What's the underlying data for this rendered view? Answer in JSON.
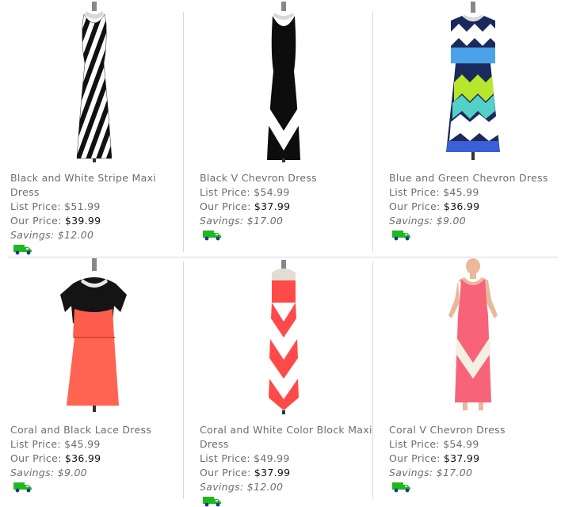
{
  "labels": {
    "list_price": "List Price:",
    "our_price": "Our Price:",
    "savings": "Savings:"
  },
  "products": [
    {
      "title": "Black and White Stripe Maxi Dress",
      "list_price": "$51.99",
      "our_price": "$39.99",
      "savings": "$12.00",
      "icon": "shipping-truck-icon"
    },
    {
      "title": "Black V Chevron Dress",
      "list_price": "$54.99",
      "our_price": "$37.99",
      "savings": "$17.00",
      "icon": "shipping-truck-icon"
    },
    {
      "title": "Blue and Green Chevron Dress",
      "list_price": "$45.99",
      "our_price": "$36.99",
      "savings": "$9.00",
      "icon": "shipping-truck-icon"
    },
    {
      "title": "Coral and Black Lace Dress",
      "list_price": "$45.99",
      "our_price": "$36.99",
      "savings": "$9.00",
      "icon": "shipping-truck-icon"
    },
    {
      "title": "Coral and White Color Block Maxi Dress",
      "list_price": "$49.99",
      "our_price": "$37.99",
      "savings": "$12.00",
      "icon": "shipping-truck-icon"
    },
    {
      "title": "Coral V Chevron Dress",
      "list_price": "$54.99",
      "our_price": "$37.99",
      "savings": "$17.00",
      "icon": "shipping-truck-icon"
    }
  ],
  "colors": {
    "text": "#6d6d6d",
    "price": "#111111",
    "truck": "#1fb81f",
    "divider": "#d9d9d9"
  }
}
